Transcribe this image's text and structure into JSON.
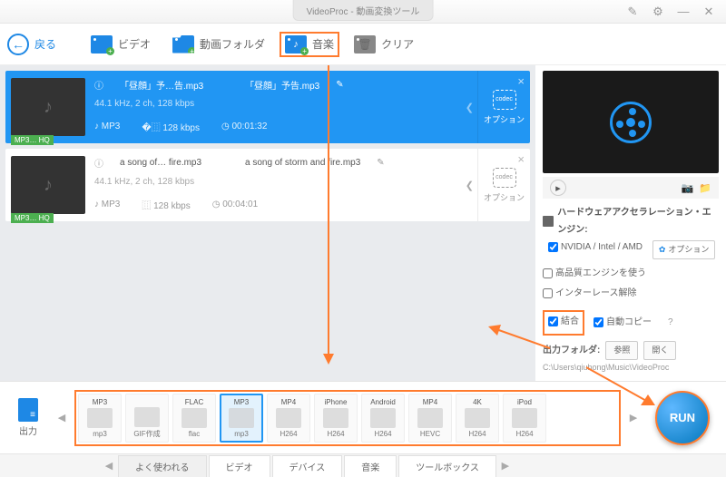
{
  "titlebar": {
    "title": "VideoProc - 動画変換ツール"
  },
  "toolbar": {
    "back": "戻る",
    "video": "ビデオ",
    "folder": "動画フォルダ",
    "music": "音楽",
    "clear": "クリア"
  },
  "items": [
    {
      "src_name": "「昼顔」予…告.mp3",
      "out_name": "「昼顔」予告.mp3",
      "info": "44.1 kHz, 2 ch, 128 kbps",
      "fmt": "MP3",
      "bitrate": "128 kbps",
      "duration": "00:01:32",
      "badge": "MP3… HQ",
      "option": "オプション",
      "selected": true
    },
    {
      "src_name": "a song of… fire.mp3",
      "out_name": "a song of storm and fire.mp3",
      "info": "44.1 kHz, 2 ch, 128 kbps",
      "fmt": "MP3",
      "bitrate": "128 kbps",
      "duration": "00:04:01",
      "badge": "MP3… HQ",
      "option": "オプション",
      "selected": false
    }
  ],
  "sidebar": {
    "hw_title": "ハードウェアアクセラレーション・エンジン:",
    "hw_label": "NVIDIA / Intel / AMD",
    "hw_option": "オプション",
    "hq_engine": "高品質エンジンを使う",
    "deinterlace": "インターレース解除",
    "merge": "結合",
    "autocopy": "自動コピー",
    "out_folder_label": "出力フォルダ:",
    "out_folder_path": "C:\\Users\\qiuhong\\Music\\VideoProc",
    "browse": "参照",
    "open": "開く"
  },
  "output": {
    "label": "出力",
    "formats": [
      {
        "t": "MP3",
        "b": "mp3"
      },
      {
        "t": "",
        "b": "GIF作成"
      },
      {
        "t": "FLAC",
        "b": "flac"
      },
      {
        "t": "MP3",
        "b": "mp3",
        "sel": true
      },
      {
        "t": "MP4",
        "b": "H264"
      },
      {
        "t": "iPhone",
        "b": "H264"
      },
      {
        "t": "Android",
        "b": "H264"
      },
      {
        "t": "MP4",
        "b": "HEVC"
      },
      {
        "t": "4K",
        "b": "H264"
      },
      {
        "t": "iPod",
        "b": "H264"
      }
    ],
    "run": "RUN"
  },
  "tabs": {
    "items": [
      "よく使われる",
      "ビデオ",
      "デバイス",
      "音楽",
      "ツールボックス"
    ],
    "active": 0
  }
}
